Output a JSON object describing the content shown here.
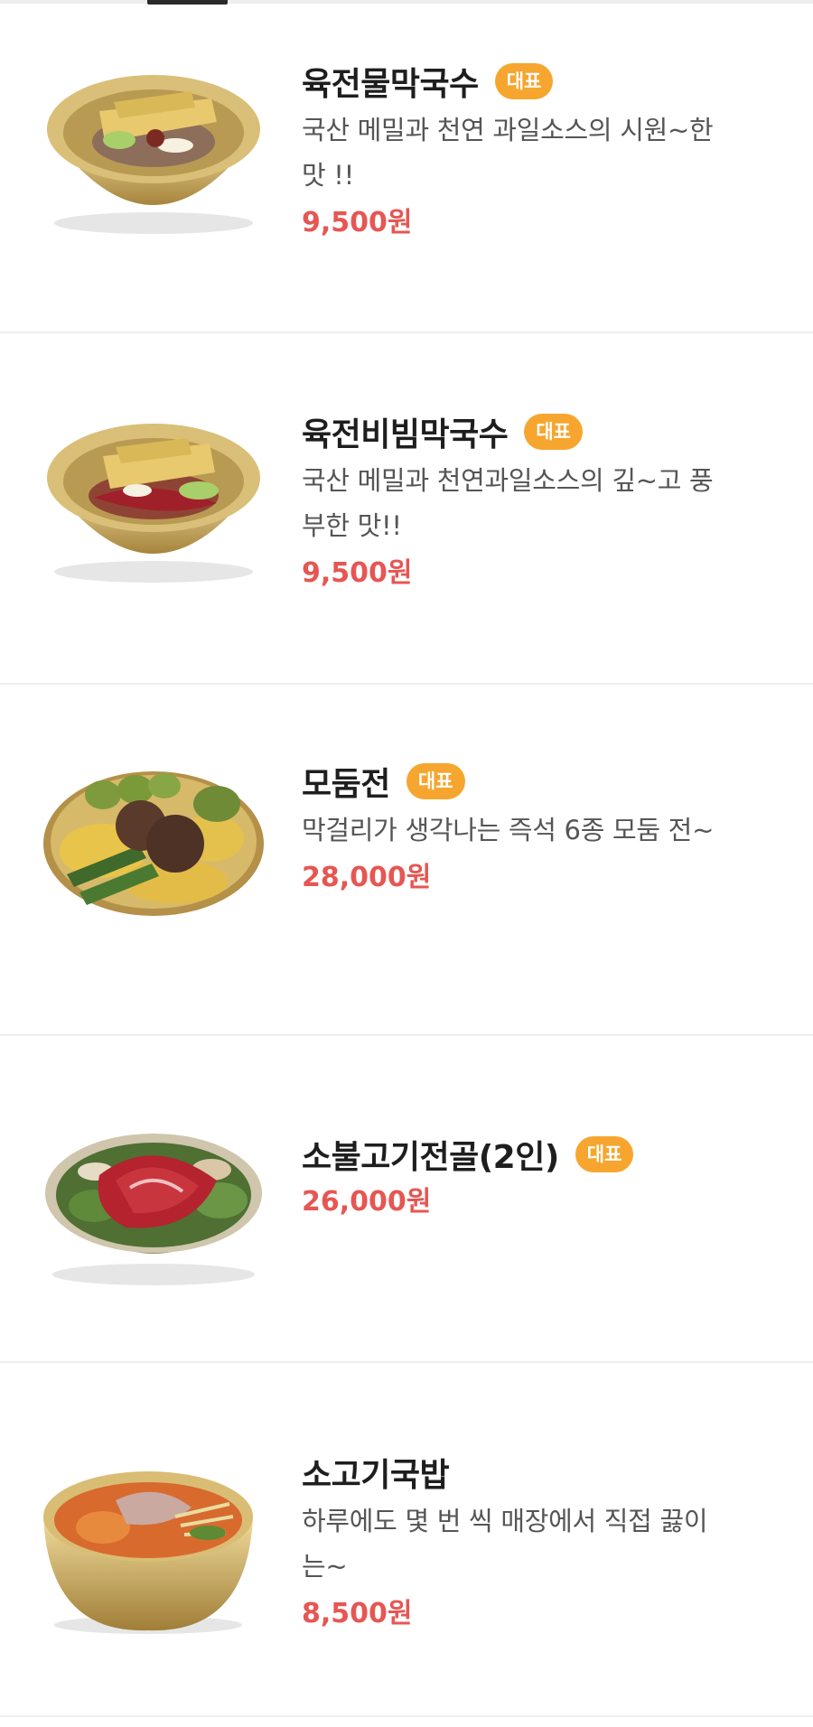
{
  "menu": [
    {
      "name": "육전물막국수",
      "badge": "대표",
      "desc": [
        "국산 메밀과 천연 과일소스의 시원~한",
        "맛 !!"
      ],
      "price": "9,500원",
      "image": "naengmyeon-bowl-icon"
    },
    {
      "name": "육전비빔막국수",
      "badge": "대표",
      "desc": [
        "국산 메밀과 천연과일소스의 깊~고 풍",
        "부한 맛!!"
      ],
      "price": "9,500원",
      "image": "bibim-naengmyeon-bowl-icon"
    },
    {
      "name": "모둠전",
      "badge": "대표",
      "desc": [
        "막걸리가 생각나는 즉석 6종 모둠 전~"
      ],
      "price": "28,000원",
      "image": "jeon-platter-icon"
    },
    {
      "name": "소불고기전골(2인)",
      "badge": "대표",
      "desc": [],
      "price": "26,000원",
      "image": "bulgogi-hotpot-icon"
    },
    {
      "name": "소고기국밥",
      "badge": "",
      "desc": [
        "하루에도 몇 번 씩 매장에서 직접 끓이",
        "는~"
      ],
      "price": "8,500원",
      "image": "gukbap-bowl-icon"
    }
  ]
}
